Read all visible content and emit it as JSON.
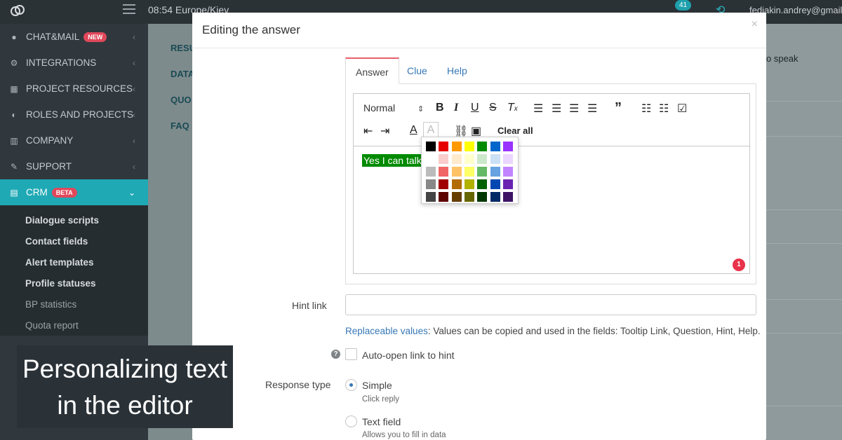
{
  "topbar": {
    "time": "08:54  Europe/Kiev",
    "notif_count": "41",
    "user_email": "fediakin.andrey@gmail.com"
  },
  "sidebar": {
    "items": [
      {
        "label": "CHAT&MAIL",
        "badge": "NEW",
        "icon": "chat-icon"
      },
      {
        "label": "INTEGRATIONS",
        "icon": "gears-icon"
      },
      {
        "label": "PROJECT RESOURCES",
        "icon": "grid-icon"
      },
      {
        "label": "ROLES AND PROJECTS",
        "icon": "toggle-icon"
      },
      {
        "label": "COMPANY",
        "icon": "bar-chart-icon"
      },
      {
        "label": "SUPPORT",
        "icon": "wrench-icon"
      },
      {
        "label": "CRM",
        "badge": "BETA",
        "icon": "crm-icon"
      }
    ],
    "sub_items": [
      "Dialogue scripts",
      "Contact fields",
      "Alert templates",
      "Profile statuses",
      "BP statistics",
      "Quota report"
    ]
  },
  "background": {
    "tabs": [
      "RESU",
      "DATA",
      "QUO",
      "FAQ"
    ],
    "right_text": "o speak"
  },
  "caption": {
    "line1": "Personalizing text",
    "line2": "in the editor"
  },
  "modal": {
    "title": "Editing the answer",
    "close": "×",
    "tabs": [
      "Answer",
      "Clue",
      "Help"
    ],
    "toolbar": {
      "format": "Normal",
      "clear_all": "Clear all"
    },
    "editor_text": "Yes I can talk",
    "counter": "1",
    "hint_link_label": "Hint link",
    "hint_link_value": "",
    "replaceable_link": "Replaceable values",
    "replaceable_text": ": Values can be copied and used in the fields: Tooltip Link, Question, Hint, Help.",
    "auto_open_label": "Auto-open link to hint",
    "response_type_label": "Response type",
    "options": [
      {
        "label": "Simple",
        "sub": "Click reply",
        "selected": true
      },
      {
        "label": "Text field",
        "sub": "Allows you to fill in data",
        "selected": false
      }
    ]
  },
  "palette_colors": [
    [
      "#000000",
      "#e60000",
      "#ff9900",
      "#ffff00",
      "#008a00",
      "#0066cc",
      "#9933ff"
    ],
    [
      "#ffffff",
      "#facccc",
      "#ffebcc",
      "#ffffcc",
      "#cce8cc",
      "#cce0f5",
      "#ebd6ff"
    ],
    [
      "#bbbbbb",
      "#f06666",
      "#ffc266",
      "#ffff66",
      "#66b966",
      "#66a3e0",
      "#c285ff"
    ],
    [
      "#888888",
      "#a10000",
      "#b26b00",
      "#b2b200",
      "#006100",
      "#0047b2",
      "#6b24b2"
    ],
    [
      "#444444",
      "#5c0000",
      "#663d00",
      "#666600",
      "#003700",
      "#002966",
      "#3d1466"
    ]
  ]
}
